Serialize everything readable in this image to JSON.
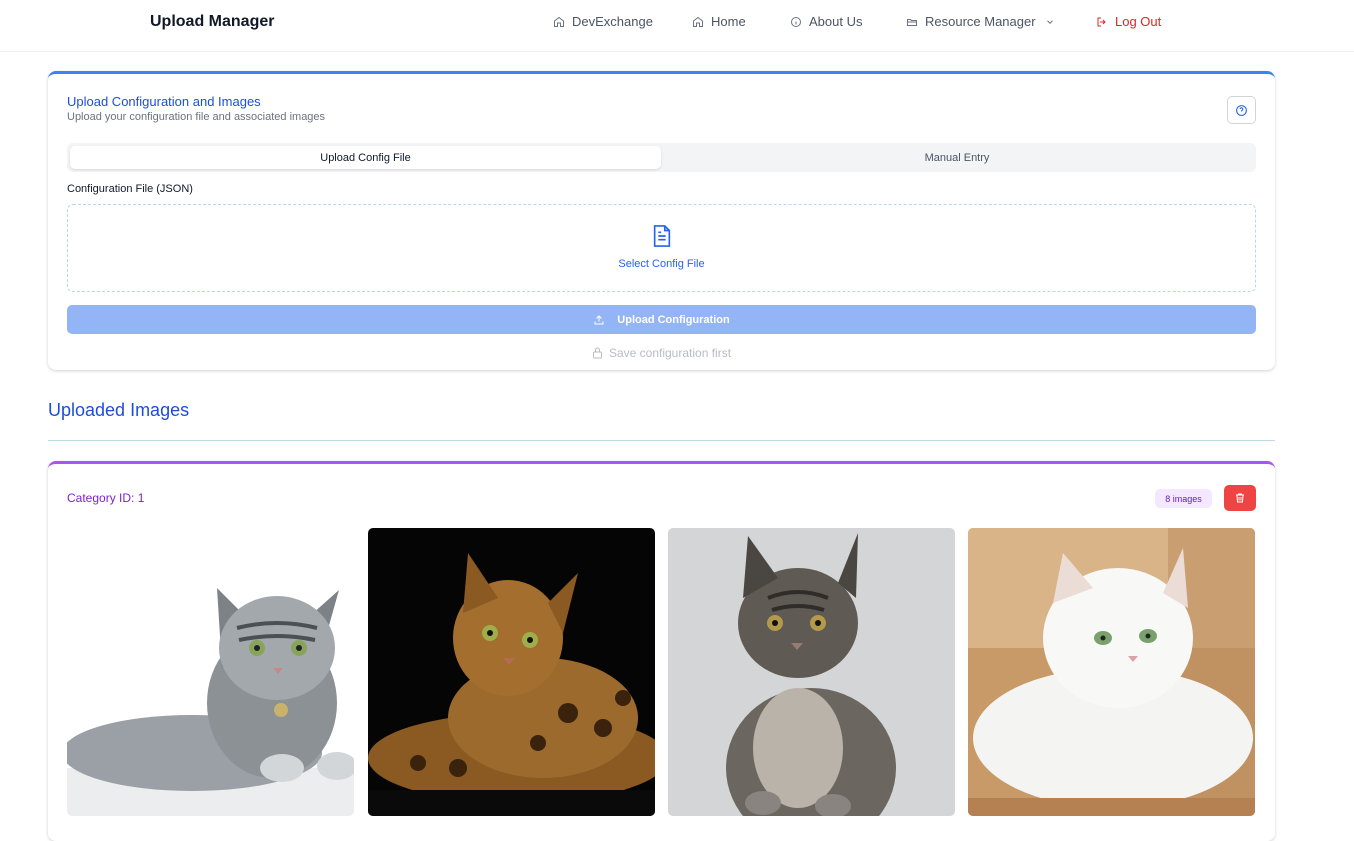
{
  "navbar": {
    "brand": "Upload Manager",
    "items": [
      {
        "label": "DevExchange",
        "icon": "home-icon"
      },
      {
        "label": "Home",
        "icon": "home-icon"
      },
      {
        "label": "About Us",
        "icon": "info-icon"
      },
      {
        "label": "Resource Manager",
        "icon": "folder-open-icon",
        "dropdown": "chevron-down-icon"
      },
      {
        "label": "Log Out",
        "icon": "logout-icon"
      }
    ]
  },
  "config": {
    "title": "Upload Configuration and Images",
    "subtitle": "Upload your configuration file and associated images",
    "help_icon": "help-circle-icon",
    "tabs": [
      {
        "label": "Upload Config File",
        "active": true
      },
      {
        "label": "Manual Entry",
        "active": false
      }
    ],
    "field_label": "Configuration File (JSON)",
    "dropzone_label": "Select Config File",
    "dropzone_icon": "file-text-icon",
    "upload_button": "Upload Configuration",
    "upload_icon": "upload-icon",
    "save_hint": "Save configuration first",
    "save_hint_icon": "lock-icon"
  },
  "images_section": {
    "title": "Uploaded Images",
    "categories": [
      {
        "title": "Category ID: 1",
        "count_badge": "8 images",
        "delete_icon": "trash-icon",
        "thumbnails": [
          {
            "subject": "silver tabby cat"
          },
          {
            "subject": "bengal cat"
          },
          {
            "subject": "maine coon kitten"
          },
          {
            "subject": "white persian cat"
          }
        ]
      }
    ]
  },
  "colors": {
    "primary": "#1d4ed8",
    "accent_purple": "#7e22ce",
    "danger": "#ef4444",
    "upload_disabled": "#93b4f5"
  }
}
